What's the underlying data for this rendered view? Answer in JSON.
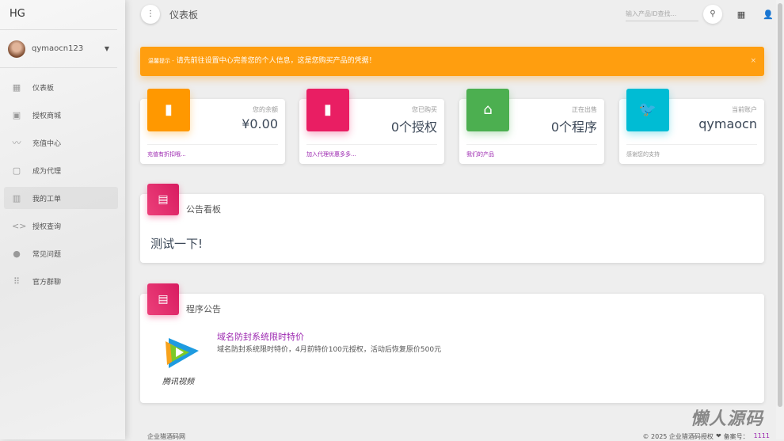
{
  "sidebar": {
    "logo": "HG",
    "username": "qymaocn123",
    "items": [
      {
        "label": "仪表板",
        "icon": "dashboard-icon",
        "glyph": "▦"
      },
      {
        "label": "授权商城",
        "icon": "shopping-bag-icon",
        "glyph": "▣"
      },
      {
        "label": "充值中心",
        "icon": "trending-icon",
        "glyph": "〰"
      },
      {
        "label": "成为代理",
        "icon": "clipboard-icon",
        "glyph": "▢"
      },
      {
        "label": "我的工单",
        "icon": "building-icon",
        "glyph": "▥"
      },
      {
        "label": "授权查询",
        "icon": "code-icon",
        "glyph": "<>"
      },
      {
        "label": "常见问题",
        "icon": "location-pin-icon",
        "glyph": "●"
      },
      {
        "label": "官方群聊",
        "icon": "apps-grid-icon",
        "glyph": "⠿"
      }
    ]
  },
  "topbar": {
    "title": "仪表板",
    "search_placeholder": "输入产品ID查找..."
  },
  "alert": {
    "prefix": "温馨提示 -",
    "message": " 请先前往设置中心完善您的个人信息，这是您购买产品的凭据！",
    "close": "×"
  },
  "stats": [
    {
      "category": "您的余额",
      "value": "¥0.00",
      "footer": "充值有折扣哦...",
      "color": "#ff9800",
      "icon": "bar-chart-icon",
      "glyph": "▮"
    },
    {
      "category": "您已购买",
      "value": "0个授权",
      "footer": "加入代理优惠多多...",
      "color": "#e91e63",
      "icon": "bar-chart-icon",
      "glyph": "▮"
    },
    {
      "category": "正在出售",
      "value": "0个程序",
      "footer": "我们的产品",
      "color": "#4caf50",
      "icon": "store-icon",
      "glyph": "⌂"
    },
    {
      "category": "当前账户",
      "value": "qymaocn",
      "footer": "感谢您的支持",
      "color": "#00bcd4",
      "icon": "twitter-icon",
      "glyph": "🐦"
    }
  ],
  "notice": {
    "title": "公告看板",
    "content": "测试一下!"
  },
  "programs": {
    "title": "程序公告",
    "items": [
      {
        "name": "域名防封系统限时特价",
        "desc": "域名防封系统限时特价，4月前特价100元授权，活动后恢复原价500元",
        "logo_text": "腾讯视频"
      }
    ]
  },
  "footer": {
    "left": "企业猎酒码网",
    "copyright": "© 2025 企业猎酒码授权",
    "icp_label": "备案号：",
    "icp": "1111"
  },
  "watermark": "懒人源码"
}
